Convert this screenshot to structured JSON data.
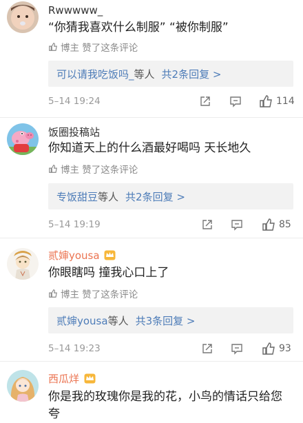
{
  "comments": [
    {
      "username": "Rwwwww_",
      "content": "“你猜我喜欢什么制服” “被你制服”",
      "liked_text": "博主 赞了这条评论",
      "reply_who": "可以请我吃饭吗_",
      "reply_etc": "等人",
      "reply_count": "共2条回复 >",
      "time": "5–14  19:24",
      "likes": "114"
    },
    {
      "username": "饭圈投稿站",
      "content": "你知道天上的什么酒最好喝吗 天长地久",
      "liked_text": "博主 赞了这条评论",
      "reply_who": "专饭甜豆",
      "reply_etc": "等人",
      "reply_count": "共2条回复 >",
      "time": "5–14  19:19",
      "likes": "85"
    },
    {
      "username": "贰婶yousa",
      "content": "你眼瞎吗 撞我心口上了",
      "liked_text": "博主 赞了这条评论",
      "reply_who": "贰婶yousa",
      "reply_etc": "等人",
      "reply_count": "共3条回复 >",
      "time": "5–14  19:23",
      "likes": "93"
    },
    {
      "username": "西瓜烊",
      "content": "你是我的玫瑰你是我的花，小鸟的情话只给您夸"
    }
  ]
}
